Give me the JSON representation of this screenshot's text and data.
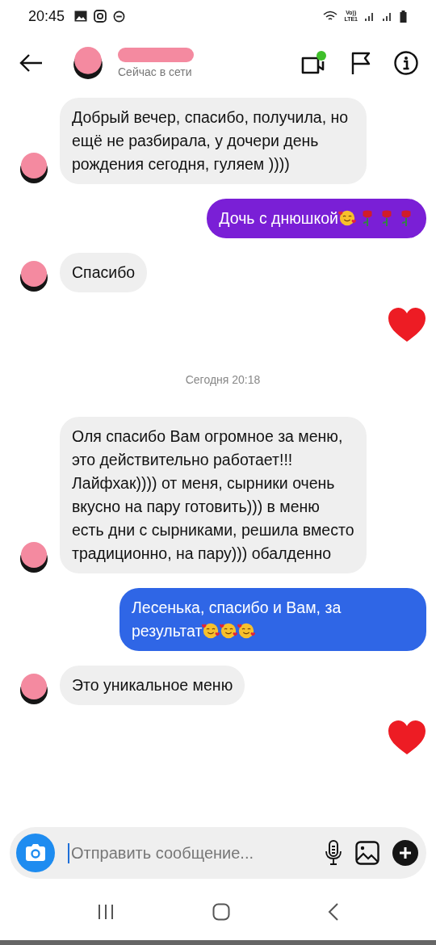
{
  "status_bar": {
    "time": "20:45",
    "volte_label": "Vo))",
    "lte_label": "LTE1"
  },
  "header": {
    "subtitle": "Сейчас в сети"
  },
  "messages": [
    {
      "kind": "incoming",
      "text": "Добрый вечер, спасибо, получила, но ещё не разбирала, у дочери день рождения сегодня, гуляем ))))"
    },
    {
      "kind": "outgoing",
      "color": "#7a1fd6",
      "text": "Дочь с днюшкой",
      "emoji": [
        {
          "kind": "hearts-face"
        },
        {
          "kind": "rose"
        },
        {
          "kind": "rose"
        },
        {
          "kind": "rose"
        }
      ]
    },
    {
      "kind": "incoming",
      "text": "Спасибо"
    },
    {
      "kind": "heart"
    },
    {
      "kind": "time",
      "text": "Сегодня 20:18"
    },
    {
      "kind": "incoming",
      "text": "Оля спасибо Вам огромное за меню, это действительно работает!!! Лайфхак)))) от меня, сырники очень вкусно на пару готовить))) в меню есть дни с сырниками, решила вместо традиционно, на пару))) обалденно"
    },
    {
      "kind": "outgoing",
      "color": "#2f66e6",
      "text": "Лесенька, спасибо и Вам, за результат",
      "emoji": [
        {
          "kind": "hearts-face"
        },
        {
          "kind": "hearts-face"
        },
        {
          "kind": "hearts-face"
        }
      ]
    },
    {
      "kind": "incoming",
      "text": "Это уникальное меню"
    },
    {
      "kind": "heart"
    }
  ],
  "composer": {
    "placeholder": "Отправить сообщение..."
  }
}
